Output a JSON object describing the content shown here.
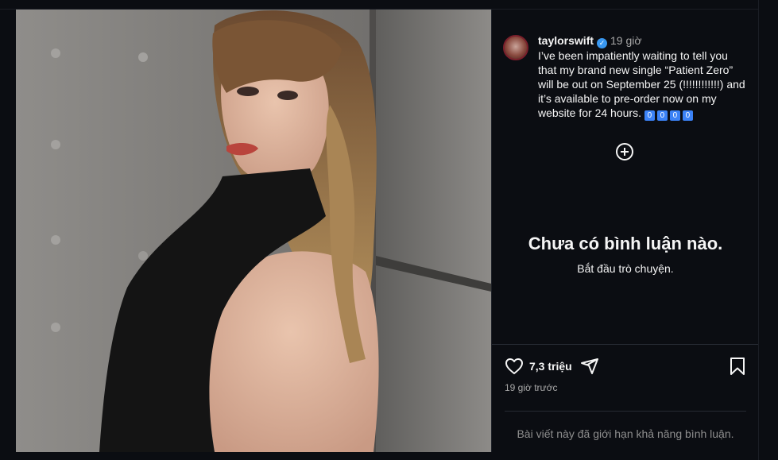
{
  "post": {
    "username": "taylorswift",
    "time_ago": "19 giờ",
    "caption": "I’ve been impatiently waiting to tell you that my brand new single “Patient Zero” will be out on September 25 (!!!!!!!!!!!!) and it’s available to pre-order now on my website for 24 hours.",
    "emojis": [
      "0",
      "0",
      "0",
      "0"
    ]
  },
  "comments": {
    "empty_title": "Chưa có bình luận nào.",
    "empty_subtitle": "Bắt đầu trò chuyện."
  },
  "actions": {
    "like_count": "7,3 triệu",
    "timestamp": "19 giờ trước",
    "comments_limited": "Bài viết này đã giới hạn khả năng bình luận."
  },
  "icons": [
    "verified-icon",
    "add-comment-icon",
    "heart-icon",
    "share-icon",
    "bookmark-icon"
  ],
  "colors": {
    "background": "#0b0d12",
    "verified": "#3897f0",
    "muted_text": "#a8a8a8"
  }
}
